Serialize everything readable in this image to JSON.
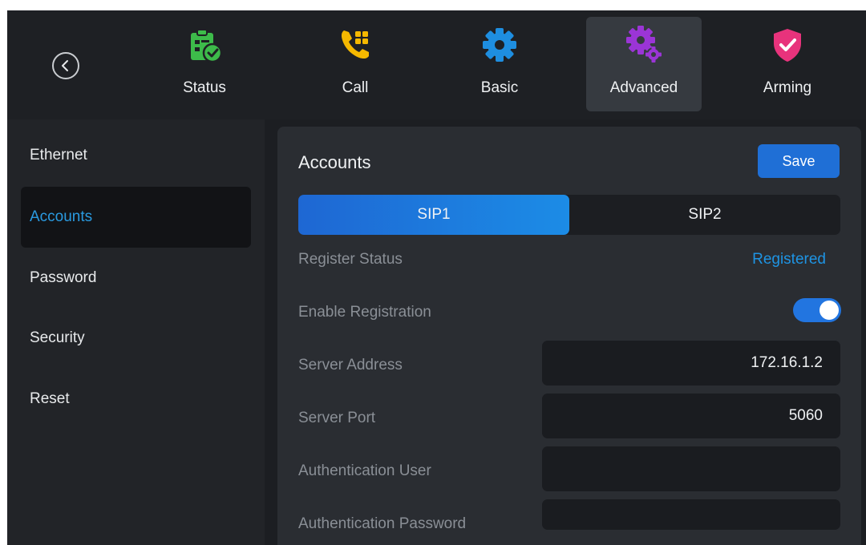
{
  "topbar": {
    "tabs": [
      {
        "label": "Status",
        "icon": "status-clipboard-check-icon"
      },
      {
        "label": "Call",
        "icon": "call-phone-icon"
      },
      {
        "label": "Basic",
        "icon": "basic-gear-icon"
      },
      {
        "label": "Advanced",
        "icon": "advanced-gears-icon"
      },
      {
        "label": "Arming",
        "icon": "arming-shield-icon"
      }
    ],
    "active_tab": "Advanced"
  },
  "sidebar": {
    "items": [
      {
        "label": "Ethernet"
      },
      {
        "label": "Accounts"
      },
      {
        "label": "Password"
      },
      {
        "label": "Security"
      },
      {
        "label": "Reset"
      }
    ],
    "active_item": "Accounts"
  },
  "panel": {
    "title": "Accounts",
    "save_label": "Save",
    "segments": [
      "SIP1",
      "SIP2"
    ],
    "active_segment": "SIP1",
    "rows": {
      "register_status": {
        "label": "Register Status",
        "value": "Registered"
      },
      "enable_registration": {
        "label": "Enable Registration",
        "enabled": true
      },
      "server_address": {
        "label": "Server Address",
        "value": "172.16.1.2"
      },
      "server_port": {
        "label": "Server Port",
        "value": "5060"
      },
      "auth_user": {
        "label": "Authentication User",
        "value": ""
      },
      "auth_password": {
        "label": "Authentication Password",
        "value": ""
      }
    }
  },
  "colors": {
    "accent_blue": "#1f6fd6",
    "status_blue": "#1e94e4",
    "status_green": "#3dbb4a",
    "call_yellow": "#f5b800",
    "advanced_purple": "#9b35d6",
    "arming_pink": "#e8337c"
  }
}
